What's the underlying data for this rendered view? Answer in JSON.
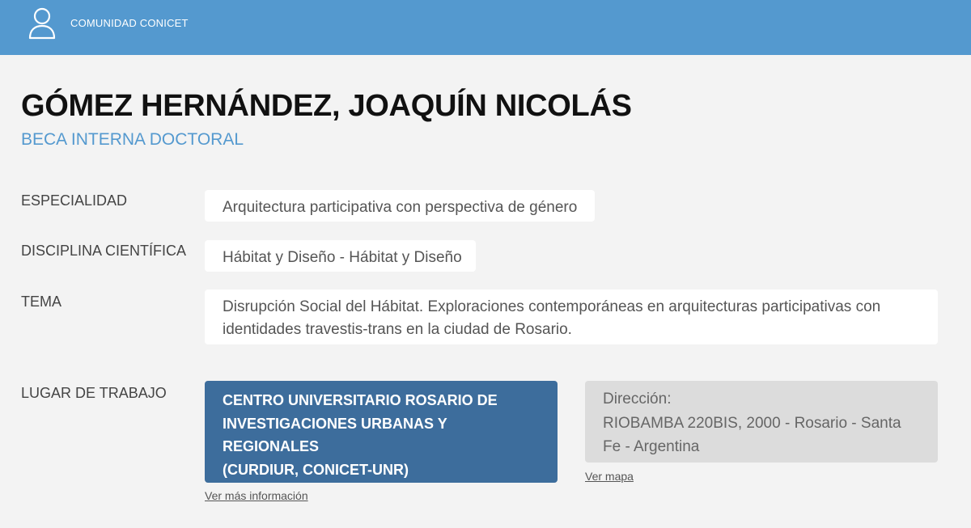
{
  "header": {
    "brand": "COMUNIDAD CONICET",
    "icon": "user-icon",
    "color": "#5499cf"
  },
  "profile": {
    "name": "GÓMEZ HERNÁNDEZ, JOAQUÍN NICOLÁS",
    "role": "BECA INTERNA DOCTORAL"
  },
  "fields": {
    "especialidad": {
      "label": "ESPECIALIDAD",
      "value": "Arquitectura participativa con perspectiva de género"
    },
    "disciplina": {
      "label": "DISCIPLINA CIENTÍFICA",
      "value": "Hábitat y Diseño - Hábitat y Diseño"
    },
    "tema": {
      "label": "TEMA",
      "value": "Disrupción Social del Hábitat. Exploraciones contemporáneas en arquitecturas participativas con identidades travestis-trans en la ciudad de Rosario."
    }
  },
  "workplace": {
    "label": "LUGAR DE TRABAJO",
    "org_lines": [
      "CENTRO UNIVERSITARIO ROSARIO DE",
      "INVESTIGACIONES URBANAS Y",
      "REGIONALES",
      "(CURDIUR, CONICET-UNR)"
    ],
    "org_color": "#3d6d9c",
    "more_info_link": "Ver más información",
    "address_label": "Dirección:",
    "address": "RIOBAMBA 220BIS, 2000 - Rosario - Santa Fe - Argentina",
    "map_link": "Ver mapa"
  }
}
